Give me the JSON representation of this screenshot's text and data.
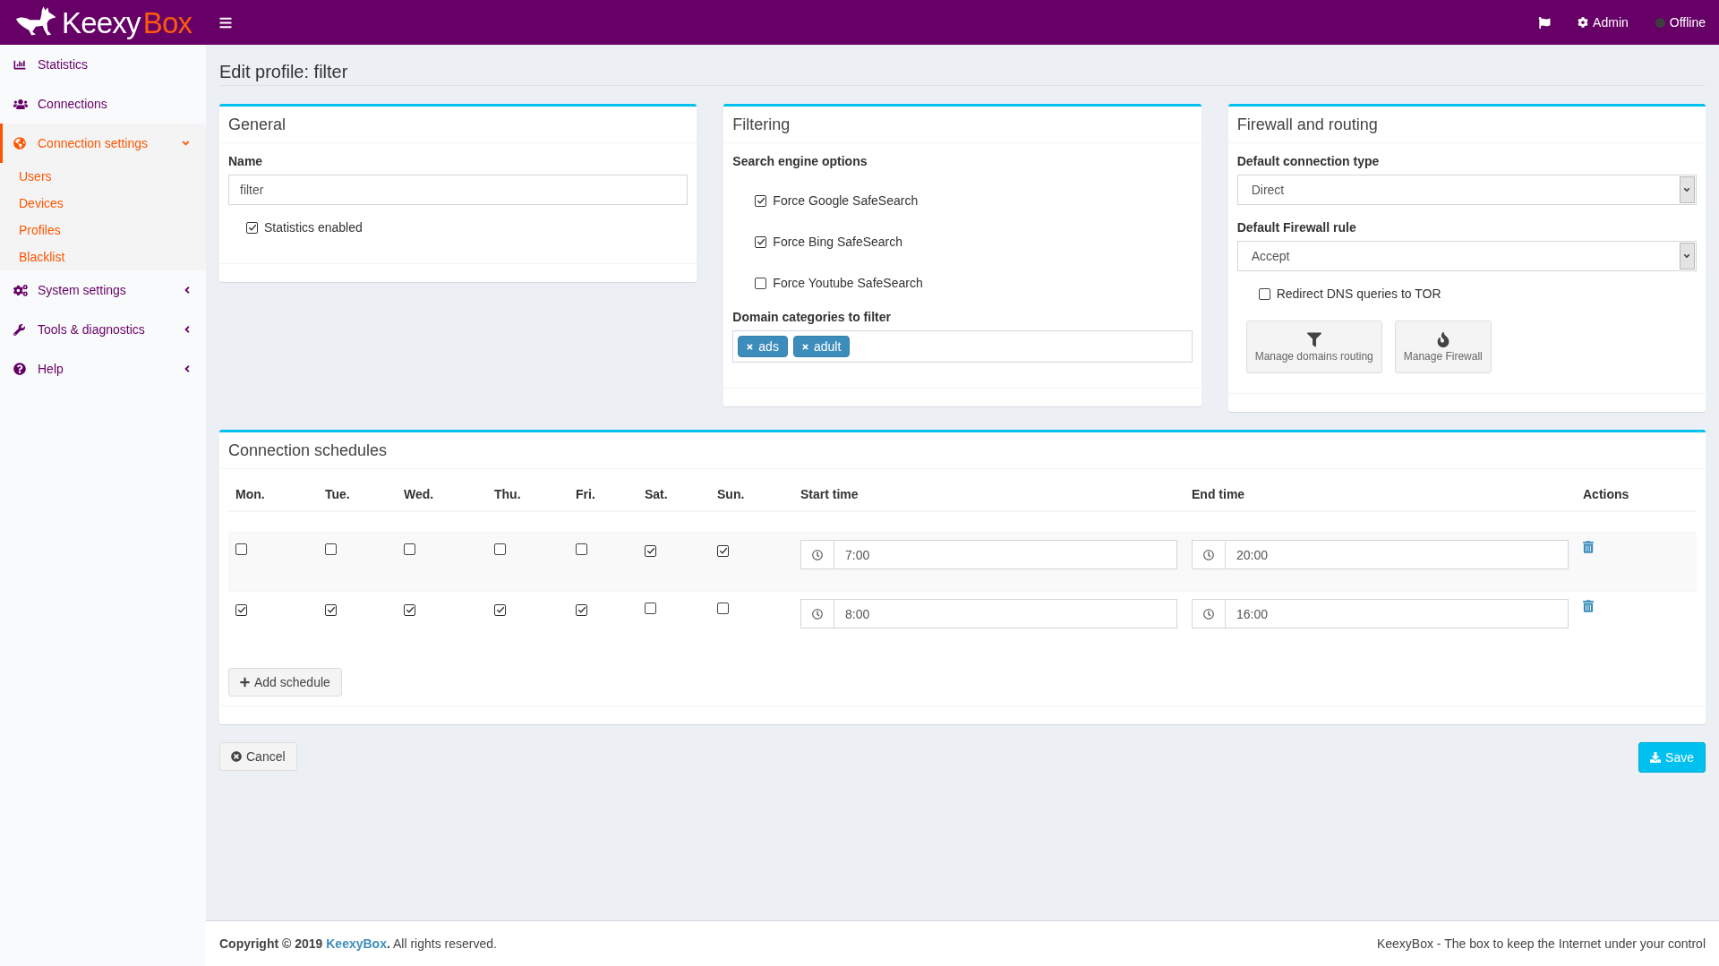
{
  "header": {
    "logo": {
      "name": "Keexy",
      "accent": "Box"
    },
    "user": "Admin",
    "status": {
      "label": "Offline",
      "online": false
    }
  },
  "sidebar": {
    "items": [
      {
        "kind": "link",
        "label": "Statistics",
        "selected": false
      },
      {
        "kind": "link",
        "label": "Connections",
        "selected": false
      },
      {
        "kind": "menu",
        "label": "Connection settings",
        "selected": true,
        "expanded": true,
        "children": [
          {
            "label": "Users"
          },
          {
            "label": "Devices"
          },
          {
            "label": "Profiles"
          },
          {
            "label": "Blacklist"
          }
        ]
      },
      {
        "kind": "menu",
        "label": "System settings",
        "selected": false,
        "expanded": false
      },
      {
        "kind": "menu",
        "label": "Tools & diagnostics",
        "selected": false,
        "expanded": false
      },
      {
        "kind": "menu",
        "label": "Help",
        "selected": false,
        "expanded": false
      }
    ]
  },
  "page_title": "Edit profile: filter",
  "general": {
    "title": "General",
    "name_label": "Name",
    "name_value": "filter",
    "statistics": {
      "label": "Statistics enabled",
      "checked": true
    }
  },
  "filtering": {
    "title": "Filtering",
    "search_label": "Search engine options",
    "options": [
      {
        "label": "Force Google SafeSearch",
        "checked": true
      },
      {
        "label": "Force Bing SafeSearch",
        "checked": true
      },
      {
        "label": "Force Youtube SafeSearch",
        "checked": false
      }
    ],
    "categories_label": "Domain categories to filter",
    "tags": [
      {
        "label": "ads"
      },
      {
        "label": "adult"
      }
    ]
  },
  "firewall": {
    "title": "Firewall and routing",
    "connection_type": {
      "label": "Default connection type",
      "value": "Direct"
    },
    "firewall_rule": {
      "label": "Default Firewall rule",
      "value": "Accept"
    },
    "redirect_dns": {
      "label": "Redirect DNS queries to TOR",
      "checked": false
    },
    "buttons": [
      {
        "label": "Manage domains routing"
      },
      {
        "label": "Manage Firewall"
      }
    ]
  },
  "schedules": {
    "title": "Connection schedules",
    "columns": [
      "Mon.",
      "Tue.",
      "Wed.",
      "Thu.",
      "Fri.",
      "Sat.",
      "Sun.",
      "Start time",
      "End time",
      "Actions"
    ],
    "rows": [
      {
        "days": [
          false,
          false,
          false,
          false,
          false,
          true,
          true
        ],
        "start": "7:00",
        "end": "20:00"
      },
      {
        "days": [
          true,
          true,
          true,
          true,
          true,
          false,
          false
        ],
        "start": "8:00",
        "end": "16:00"
      }
    ],
    "add_button": "Add schedule"
  },
  "actions": {
    "cancel": "Cancel",
    "save": "Save"
  },
  "footer": {
    "copyright": {
      "prefix": "Copyright © 2019 ",
      "link": "KeexyBox",
      "suffix": "**.** All rights reserved."
    },
    "tagline": "KeexyBox - The box to keep the Internet under your control"
  }
}
